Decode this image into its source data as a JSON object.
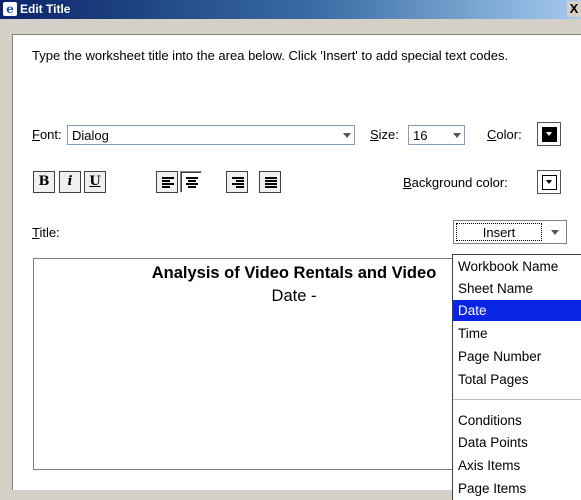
{
  "window": {
    "title": "Edit Title",
    "close_label": "X"
  },
  "instructions": "Type the worksheet title into the area below. Click 'Insert' to add special text codes.",
  "font": {
    "label_mnemonic": "F",
    "label_rest": "ont:",
    "value": "Dialog"
  },
  "size": {
    "label_mnemonic": "S",
    "label_rest": "ize:",
    "value": "16"
  },
  "color": {
    "label_mnemonic": "C",
    "label_rest": "olor:",
    "value": "#000000"
  },
  "background_color": {
    "label_mnemonic": "B",
    "label_rest": "ackground color:",
    "value": "#ffffff"
  },
  "format_buttons": {
    "bold": "B",
    "italic": "i",
    "underline": "U"
  },
  "title_field": {
    "label_mnemonic": "T",
    "label_rest": "itle:",
    "line1": "Analysis of Video Rentals and Video",
    "line2": "Date -"
  },
  "insert_button": {
    "label": "Insert"
  },
  "insert_menu": {
    "items": [
      "Workbook Name",
      "Sheet Name",
      "Date",
      "Time",
      "Page Number",
      "Total Pages",
      "Conditions",
      "Data Points",
      "Axis Items",
      "Page Items"
    ],
    "selected": "Date"
  }
}
